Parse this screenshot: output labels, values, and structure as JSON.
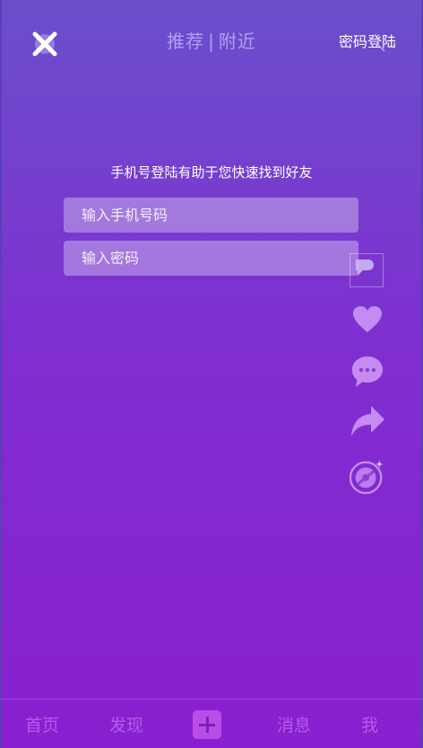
{
  "header": {
    "tab_recommend": "推荐",
    "tab_separator": "|",
    "tab_nearby": "附近",
    "password_login": "密码登陆",
    "close_icon": "close-icon"
  },
  "form": {
    "tip": "手机号登陆有助于您快速找到好友",
    "phone_placeholder": "输入手机号码",
    "password_placeholder": "输入密码"
  },
  "side_actions": [
    "avatar-icon",
    "heart-icon",
    "comment-icon",
    "share-icon",
    "music-disc-icon"
  ],
  "bottom_nav": {
    "home": "首页",
    "discover": "发现",
    "add_icon": "plus-icon",
    "messages": "消息",
    "me": "我"
  },
  "colors": {
    "gradient_top": "#6a4fcc",
    "gradient_bottom": "#8a1fcf",
    "nav_text": "#b25de8",
    "plus_bg": "#b84ee6"
  }
}
